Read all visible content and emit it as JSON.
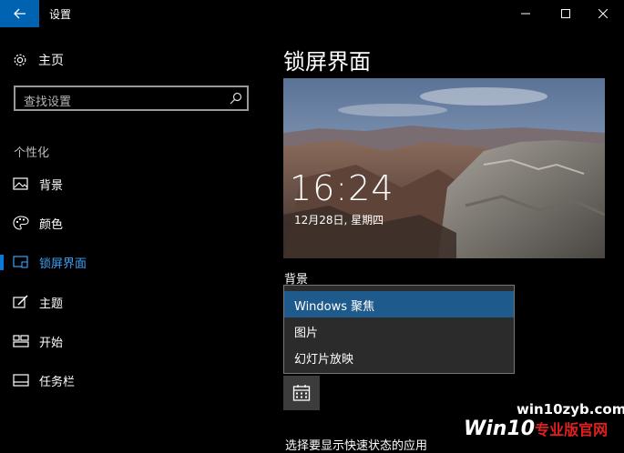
{
  "titlebar": {
    "title": "设置"
  },
  "sidebar": {
    "home_label": "主页",
    "search_placeholder": "查找设置",
    "section_title": "个性化",
    "items": [
      {
        "label": "背景",
        "icon": "picture-icon"
      },
      {
        "label": "颜色",
        "icon": "palette-icon"
      },
      {
        "label": "锁屏界面",
        "icon": "lockscreen-icon",
        "active": true
      },
      {
        "label": "主题",
        "icon": "theme-icon"
      },
      {
        "label": "开始",
        "icon": "start-icon"
      },
      {
        "label": "任务栏",
        "icon": "taskbar-icon"
      }
    ]
  },
  "main": {
    "title": "锁屏界面",
    "preview": {
      "time": "16:24",
      "date": "12月28日, 星期四"
    },
    "background_label": "背景",
    "dropdown_options": [
      "Windows 聚焦",
      "图片",
      "幻灯片放映"
    ],
    "selected_option": "Windows 聚焦",
    "bottom_text": "选择要显示快速状态的应用"
  },
  "watermark": {
    "site": "win10zyb.com",
    "logo": "Win10",
    "logo_sub": "专业版官网"
  },
  "colors": {
    "accent": "#0063b1",
    "active_nav": "#3aa0f3",
    "selected_option": "#1e5a8c"
  }
}
